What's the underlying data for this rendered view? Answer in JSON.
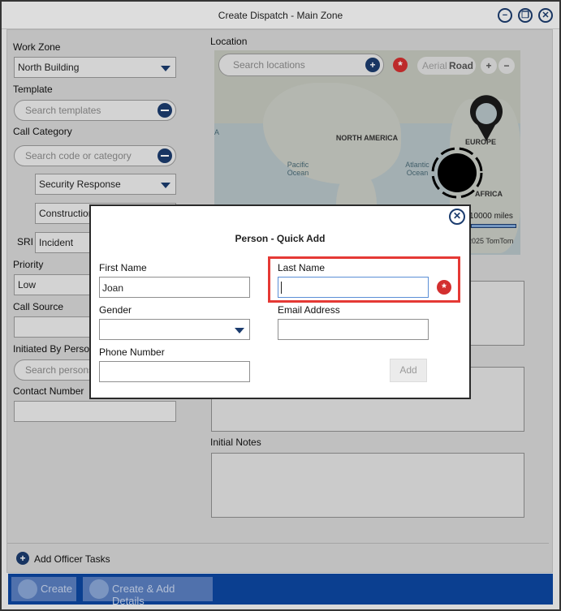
{
  "window": {
    "title": "Create Dispatch - Main Zone"
  },
  "form": {
    "work_zone_label": "Work Zone",
    "work_zone_value": "North Building",
    "template_label": "Template",
    "template_placeholder": "Search templates",
    "call_category_label": "Call Category",
    "call_category_placeholder": "Search code or category",
    "category_level1": "Security Response",
    "category_level2": "Construction",
    "sri_label": "SRI",
    "sri_value": "Incident",
    "priority_label": "Priority",
    "priority_value": "Low",
    "call_source_label": "Call Source",
    "initiated_by_label": "Initiated By Person",
    "initiated_by_placeholder": "Search persons",
    "contact_number_label": "Contact Number",
    "location_label": "Location",
    "location_placeholder": "Search locations",
    "initial_notes_label": "Initial Notes"
  },
  "map": {
    "toggle_aerial": "Aerial",
    "toggle_road": "Road",
    "zoom_in": "+",
    "zoom_out": "−",
    "labels": {
      "north_america": "NORTH AMERICA",
      "pacific": "Pacific\nOcean",
      "atlantic": "Atlantic\nOcean",
      "europe": "EUROPE",
      "africa": "AFRICA",
      "left_fragment": "A"
    },
    "scale": "10000 miles",
    "attribution": "2025 TomTom"
  },
  "actions": {
    "add_officer_tasks": "Add Officer Tasks",
    "create": "Create",
    "create_add_details": "Create & Add Details"
  },
  "modal": {
    "title": "Person - Quick Add",
    "first_name_label": "First Name",
    "first_name_value": "Joan",
    "last_name_label": "Last Name",
    "last_name_value": "",
    "gender_label": "Gender",
    "gender_value": "",
    "email_label": "Email Address",
    "email_value": "",
    "phone_label": "Phone Number",
    "phone_value": "",
    "add_button": "Add"
  },
  "colors": {
    "accent": "#0d47a1",
    "icon_navy": "#1b3c6e",
    "required": "#d32f2f",
    "highlight": "#e53935"
  }
}
